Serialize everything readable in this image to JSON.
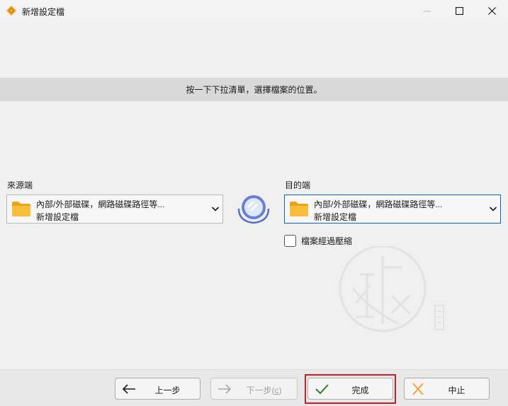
{
  "window": {
    "title": "新增設定檔"
  },
  "banner": {
    "text": "按一下下拉清單，選擇檔案的位置。"
  },
  "source": {
    "label": "來源端",
    "line1": "內部/外部磁碟，網路磁碟路徑等...",
    "line2": "新增設定檔"
  },
  "destination": {
    "label": "目的端",
    "line1": "內部/外部磁碟，網路磁碟路徑等...",
    "line2": "新增設定檔"
  },
  "compress": {
    "label": "檔案經過壓縮",
    "checked": false
  },
  "buttons": {
    "back": "上一步",
    "next": "下一步(",
    "next_accel": "c",
    "finish": "完成",
    "abort": "中止"
  },
  "colors": {
    "banner": "#d9d9d9",
    "focus_border": "#0a64b4",
    "highlight": "#d11a2a",
    "check_icon": "#2e7d32",
    "cancel_icon": "#f0a030",
    "folder": "#f5b82e"
  },
  "icons": {
    "app": "app-diamond-icon",
    "minimize": "minimize-icon",
    "maximize": "maximize-icon",
    "close": "close-icon",
    "folder": "folder-icon",
    "chevron": "chevron-down-icon",
    "mirror": "mirror-icon",
    "back": "arrow-left-icon",
    "next": "arrow-right-icon",
    "finish": "checkmark-icon",
    "abort": "x-cancel-icon"
  }
}
